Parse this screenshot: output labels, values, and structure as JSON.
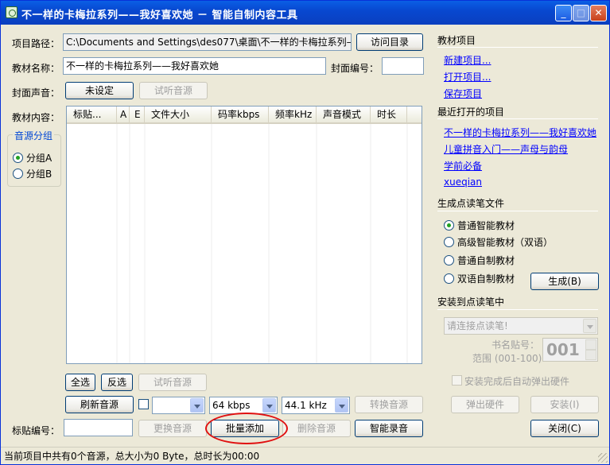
{
  "window": {
    "title": "不一样的卡梅拉系列——我好喜欢她 － 智能自制内容工具",
    "minimize": "_",
    "maximize": "□",
    "close": "✕"
  },
  "left": {
    "project_path_label": "项目路径：",
    "project_path_value": "C:\\Documents and Settings\\des077\\桌面\\不一样的卡梅拉系列——",
    "visit_dir_button": "访问目录",
    "material_name_label": "教材名称：",
    "material_name_value": "不一样的卡梅拉系列——我好喜欢她",
    "cover_id_label": "封面编号：",
    "cover_id_value": "",
    "cover_sound_label": "封面声音：",
    "unset_button": "未设定",
    "preview_audio_top": "试听音源",
    "content_label": "教材内容：",
    "audio_group_title": "音源分组",
    "group_a": "分组A",
    "group_b": "分组B",
    "columns": [
      "标贴...",
      "A",
      "E",
      "文件大小",
      "码率kbps",
      "频率kHz",
      "声音模式",
      "时长"
    ],
    "select_all": "全选",
    "invert_select": "反选",
    "preview_audio_bottom": "试听音源",
    "refresh_audio": "刷新音源",
    "bitrate_empty": "",
    "bitrate": "64 kbps",
    "frequency": "44.1 kHz",
    "convert_audio": "转换音源",
    "label_id_label": "标贴编号：",
    "label_id_value": "",
    "replace_audio": "更换音源",
    "batch_add": "批量添加",
    "delete_audio": "删除音源",
    "smart_record": "智能录音"
  },
  "right": {
    "material_project_header": "教材项目",
    "new_project": "新建项目...",
    "open_project": "打开项目...",
    "save_project": "保存项目",
    "recent_header": "最近打开的项目",
    "recent": [
      "不一样的卡梅拉系列——我好喜欢她",
      "儿童拼音入门——声母与韵母",
      "学前必备",
      "xueqian"
    ],
    "generate_header": "生成点读笔文件",
    "gen_options": [
      "普通智能教材",
      "高级智能教材（双语）",
      "普通自制教材",
      "双语自制教材"
    ],
    "generate_button": "生成(B)",
    "install_header": "安装到点读笔中",
    "pen_select": "请连接点读笔!",
    "book_id_label": "书名贴号：",
    "range_label": "范围 (001-100)",
    "book_id_value": "001",
    "auto_eject_label": "安装完成后自动弹出硬件",
    "eject_hw": "弹出硬件",
    "install_button": "安装(I)",
    "close_button": "关闭(C)"
  },
  "status": {
    "text": "当前项目中共有0个音源，总大小为0 Byte，总时长为00:00"
  }
}
